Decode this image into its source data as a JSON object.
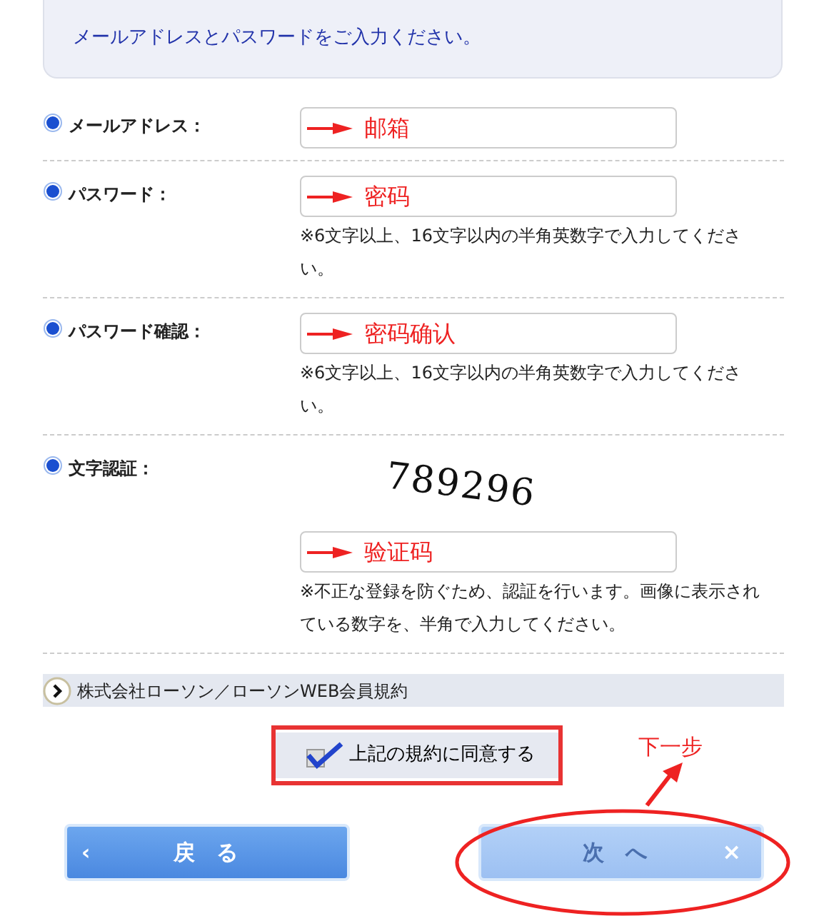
{
  "header": {
    "message": "メールアドレスとパスワードをご入力ください。"
  },
  "fields": [
    {
      "label": "メールアドレス：",
      "value": "邮箱"
    },
    {
      "label": "パスワード：",
      "value": "密码",
      "note": "※6文字以上、16文字以内の半角英数字で入力してください。"
    },
    {
      "label": "パスワード確認：",
      "value": "密码确认",
      "note": "※6文字以上、16文字以内の半角英数字で入力してください。"
    },
    {
      "label": "文字認証：",
      "captcha": "789296",
      "value": "验证码",
      "note": "※不正な登録を防ぐため、認証を行います。画像に表示されている数字を、半角で入力してください。"
    }
  ],
  "terms_link": "株式会社ローソン／ローソンWEB会員規約",
  "agree": {
    "label": "上記の規約に同意する",
    "checked": true
  },
  "buttons": [
    {
      "kind": "back",
      "icon": "‹",
      "label": "戻　る",
      "disabled": false
    },
    {
      "kind": "next",
      "label": "次　へ",
      "icon": "×",
      "disabled": true
    }
  ],
  "annotation": {
    "text": "下一步"
  }
}
